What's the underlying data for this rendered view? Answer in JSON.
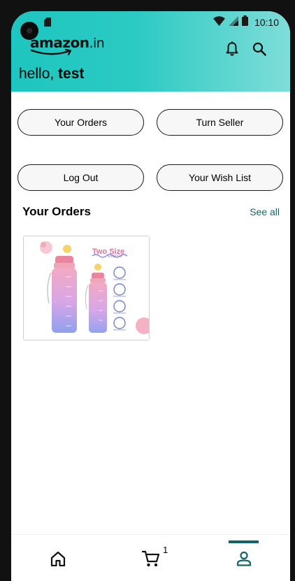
{
  "status_bar": {
    "time": "10:10"
  },
  "app_bar": {
    "logo_text": "amazon",
    "logo_suffix": ".in",
    "greeting_prefix": "hello, ",
    "user_name": "test",
    "icons": [
      "notifications-icon",
      "search-icon"
    ]
  },
  "account_buttons": {
    "your_orders": "Your Orders",
    "turn_seller": "Turn Seller",
    "log_out": "Log Out",
    "wish_list": "Your Wish List"
  },
  "orders_section": {
    "title": "Your Orders",
    "see_all": "See all",
    "items": [
      {
        "product": "water-bottle-image",
        "image_text": "Two Size",
        "image_subtext": "Choose"
      }
    ]
  },
  "bottom_nav": {
    "items": [
      "home-icon",
      "cart-icon",
      "account-icon"
    ],
    "cart_count": "1",
    "active": "account-icon",
    "accent_color": "#12666a"
  },
  "colors": {
    "appbar_gradient_start": "#1dc6bf",
    "appbar_gradient_end": "#7fddd8",
    "link": "#12666a"
  }
}
